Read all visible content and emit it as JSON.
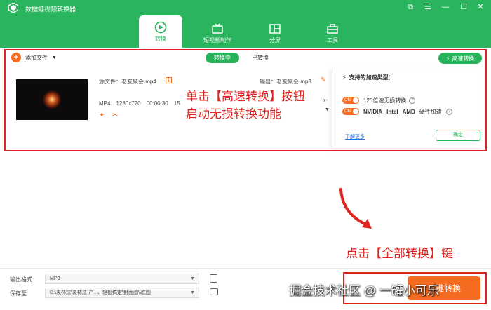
{
  "app": {
    "title": "数据蛙视频转换器"
  },
  "window_controls": [
    "⧉",
    "☰",
    "—",
    "☐",
    "✕"
  ],
  "nav": {
    "tabs": [
      {
        "label": "转换",
        "icon": "convert-icon",
        "active": true
      },
      {
        "label": "短视频制作",
        "icon": "tv-icon",
        "active": false
      },
      {
        "label": "分屏",
        "icon": "split-screen-icon",
        "active": false
      },
      {
        "label": "工具",
        "icon": "toolbox-icon",
        "active": false
      }
    ]
  },
  "toolbar": {
    "add_file": "添加文件",
    "seg_converting": "转换中",
    "seg_converted": "已转换",
    "fast_convert": "高速转换"
  },
  "file": {
    "source_label": "源文件：老友聚会.mp4",
    "output_label": "输出：老友聚会.mp3",
    "meta_format": "MP4",
    "meta_res": "1280x720",
    "meta_duration": "00:00:30",
    "meta_extra": "15",
    "x_mark": "x-"
  },
  "popup": {
    "title": "支持的加速类型：",
    "toggle_text": "ON",
    "opt1": "120倍速无损转换",
    "opt2_a": "NVIDIA",
    "opt2_b": "Intel",
    "opt2_c": "AMD",
    "opt2_d": "硬件加速",
    "learn_more": "了解更多",
    "confirm": "确定"
  },
  "annotations": {
    "a1_line1": "单击【高速转换】按钮",
    "a1_line2": "启动无损转换功能",
    "a2": "点击【全部转换】键"
  },
  "bottom": {
    "output_format_label": "输出格式:",
    "output_format_value": "MP3",
    "save_to_label": "保存至:",
    "save_to_value": "D:\\袁林炫\\袁林炫-产...、轻松搞定\\封面图\\\\底图",
    "convert_all": "一键转换"
  },
  "watermark": "掘金技术社区 @ 一罐小可乐",
  "colors": {
    "brand_green": "#27b35a",
    "accent_orange": "#f56b1f",
    "annotation_red": "#e0231e"
  }
}
